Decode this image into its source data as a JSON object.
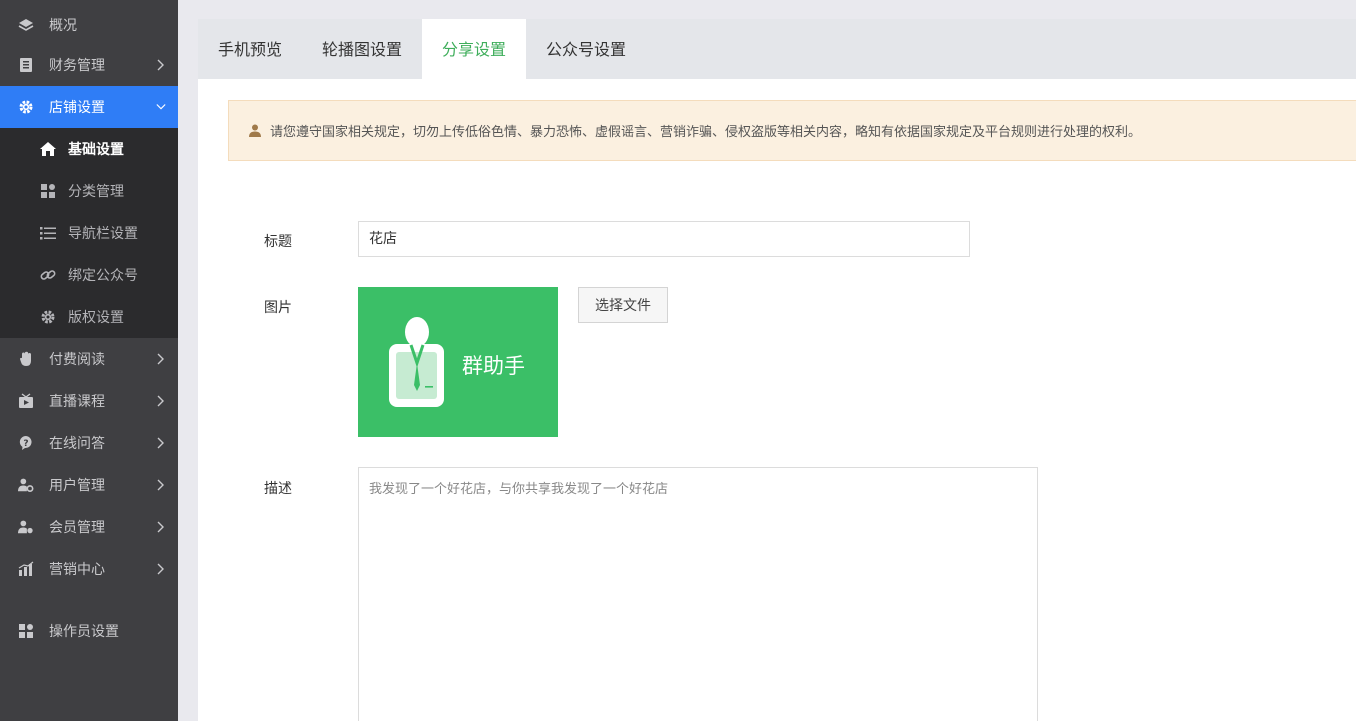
{
  "sidebar": {
    "items": [
      {
        "label": "概况",
        "icon": "layers-icon",
        "has_arrow": false
      },
      {
        "label": "财务管理",
        "icon": "ledger-icon",
        "has_arrow": true
      },
      {
        "label": "店铺设置",
        "icon": "gear-icon",
        "has_arrow": true,
        "expanded": true
      },
      {
        "label": "付费阅读",
        "icon": "hand-icon",
        "has_arrow": true
      },
      {
        "label": "直播课程",
        "icon": "tv-icon",
        "has_arrow": true
      },
      {
        "label": "在线问答",
        "icon": "question-icon",
        "has_arrow": true
      },
      {
        "label": "用户管理",
        "icon": "user-gear-icon",
        "has_arrow": true
      },
      {
        "label": "会员管理",
        "icon": "member-icon",
        "has_arrow": true
      },
      {
        "label": "营销中心",
        "icon": "bar-chart-icon",
        "has_arrow": true
      },
      {
        "label": "操作员设置",
        "icon": "grid-plus-icon",
        "has_arrow": false
      }
    ],
    "submenu": [
      {
        "label": "基础设置",
        "icon": "home-icon",
        "current": true
      },
      {
        "label": "分类管理",
        "icon": "category-icon"
      },
      {
        "label": "导航栏设置",
        "icon": "list-icon"
      },
      {
        "label": "绑定公众号",
        "icon": "link-icon"
      },
      {
        "label": "版权设置",
        "icon": "gear-icon"
      }
    ]
  },
  "tabs": [
    {
      "label": "手机预览"
    },
    {
      "label": "轮播图设置"
    },
    {
      "label": "分享设置",
      "active": true
    },
    {
      "label": "公众号设置"
    }
  ],
  "notice": {
    "text": "请您遵守国家相关规定，切勿上传低俗色情、暴力恐怖、虚假谣言、营销诈骗、侵权盗版等相关内容，略知有依据国家规定及平台规则进行处理的权利。"
  },
  "form": {
    "title_label": "标题",
    "title_value": "花店",
    "image_label": "图片",
    "image_caption": "群助手",
    "file_button": "选择文件",
    "desc_label": "描述",
    "desc_value": "我发现了一个好花店，与你共享我发现了一个好花店"
  },
  "colors": {
    "sidebar_bg": "#3f3f42",
    "submenu_bg": "#2b2b2d",
    "active_blue": "#2f7df6",
    "active_tab_green": "#3fae5b",
    "thumb_green": "#3bbf67",
    "notice_bg": "#fbf0e0"
  }
}
